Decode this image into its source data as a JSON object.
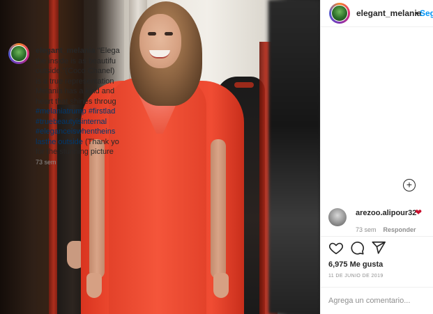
{
  "post": {
    "username": "elegant_melania",
    "dot": "•",
    "follow_label": "Segu",
    "caption_lines": [
      {
        "username": "elegant_melania",
        "text": " \"Elega"
      },
      {
        "text": "the inside is as beautifu"
      },
      {
        "text": "outside.\"(Coco Chanel)"
      },
      {
        "text": "is a true representation"
      },
      {
        "text": "Melania has a kind and"
      },
      {
        "text": "heart that shines throug"
      },
      {
        "text": "#melaniatrump #firstlad",
        "hashtag": true
      },
      {
        "text": "#truebeautyisinternal",
        "hashtag": true
      },
      {
        "text": "#eleganceiswhentheins",
        "hashtag": true
      },
      {
        "text": "lasthe outside",
        "hashtag": true,
        "trailing": " (Thank yo"
      },
      {
        "text": "for the stunning picture"
      }
    ],
    "caption_time": "73 sem",
    "more_comments_label": "+",
    "comment": {
      "username": "arezoo.alipour32",
      "heart": "❤",
      "time": "73 sem",
      "reply_label": "Responder"
    },
    "likes": "6,975 Me gusta",
    "date": "11 DE JUNIO DE 2019",
    "comment_placeholder": "Agrega un comentario..."
  },
  "colors": {
    "link": "#0095f6",
    "hashtag": "#00376b",
    "secondary_text": "#8e8e8e",
    "dress_red": "#ee4a30"
  },
  "icons": [
    "heart-icon",
    "comment-icon",
    "share-icon",
    "add-circle-icon",
    "heart-emoji-icon"
  ]
}
